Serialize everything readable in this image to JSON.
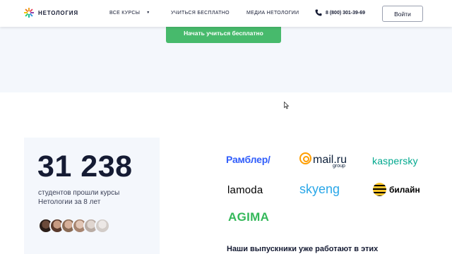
{
  "header": {
    "logo_text": "НЕТОЛОГИЯ",
    "nav": {
      "courses": "ВСЕ КУРСЫ",
      "free": "УЧИТЬСЯ БЕСПЛАТНО",
      "media": "МЕДИА НЕТОЛОГИИ"
    },
    "phone": "8 (800) 301-39-69",
    "login": "Войти"
  },
  "hero": {
    "cta": "Начать учиться бесплатно"
  },
  "stats": {
    "number": "31 238",
    "caption": "студентов прошли курсы Нетологии за 8 лет"
  },
  "partners": {
    "rambler": "Рамблер/",
    "mailru": "mail.ru",
    "mailru_group": "group",
    "kaspersky": "kaspersky",
    "lamoda": "lamoda",
    "skyeng": "skyeng",
    "beeline": "билайн",
    "agima": "AGIMA"
  },
  "graduates_heading": "Наши выпускники уже работают в этих",
  "colors": {
    "accent_green": "#47ba6c",
    "text_dark": "#151b33",
    "band_bg": "#f4f7fc"
  }
}
